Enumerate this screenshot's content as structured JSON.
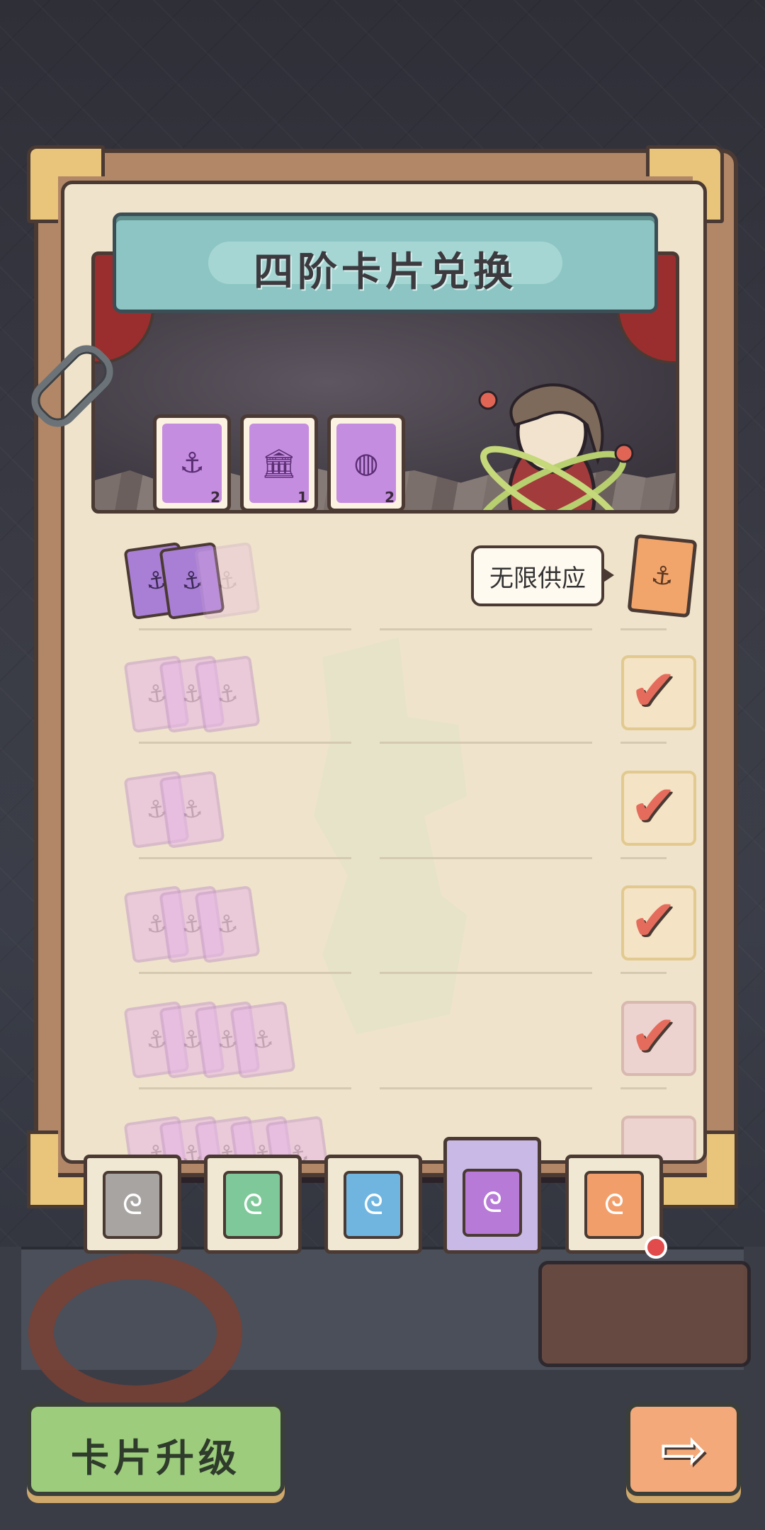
{
  "banner": {
    "title": "四阶卡片兑换",
    "required_cards": [
      {
        "icon": "anchor-icon",
        "glyph": "⚓",
        "count": "2"
      },
      {
        "icon": "capitol-icon",
        "glyph": "🏛",
        "count": "1"
      },
      {
        "icon": "globe-icon",
        "glyph": "◍",
        "count": "2"
      }
    ]
  },
  "exchange": {
    "supply_label": "无限供应",
    "rows": [
      {
        "cards": 2,
        "claimed": false
      },
      {
        "cards": 3,
        "claimed": true
      },
      {
        "cards": 2,
        "claimed": true
      },
      {
        "cards": 3,
        "claimed": true
      },
      {
        "cards": 4,
        "claimed": true
      }
    ]
  },
  "tabs": [
    {
      "name": "tier-1",
      "color": "#a8a4a2",
      "active": false
    },
    {
      "name": "tier-2",
      "color": "#7fc89a",
      "active": false
    },
    {
      "name": "tier-3",
      "color": "#6fb5e0",
      "active": false
    },
    {
      "name": "tier-4",
      "color": "#b77ad7",
      "active": true
    },
    {
      "name": "tier-5",
      "color": "#f29e6a",
      "active": false
    }
  ],
  "buttons": {
    "upgrade_label": "卡片升级",
    "next_glyph": "⇨"
  },
  "colors": {
    "accent_purple": "#a97fd6",
    "check_red": "#e56c5c",
    "banner_teal": "#8cc5c3",
    "upgrade_green": "#9ccc7c",
    "next_orange": "#f3a979"
  }
}
